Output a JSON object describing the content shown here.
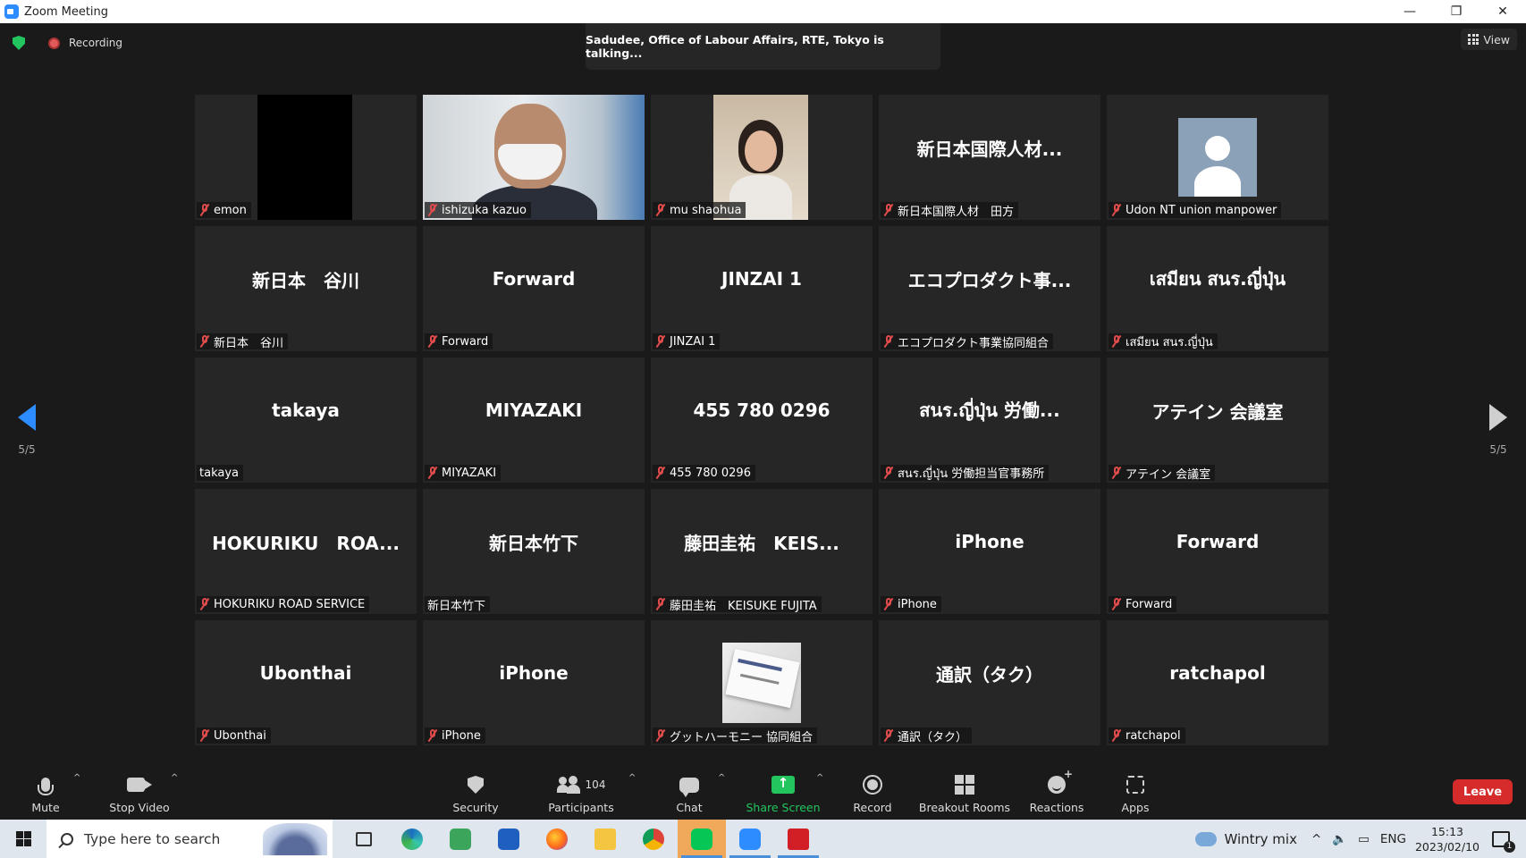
{
  "window": {
    "title": "Zoom Meeting",
    "minimize": "—",
    "restore": "❐",
    "close": "✕"
  },
  "topbar": {
    "recording": "Recording",
    "talking": "Sadudee, Office of Labour Affairs, RTE, Tokyo is talking...",
    "view_label": "View"
  },
  "pager": {
    "left": "5/5",
    "right": "5/5"
  },
  "tiles": [
    {
      "label": "emon",
      "big": "",
      "muted": true
    },
    {
      "label": "ishizuka kazuo",
      "big": "",
      "muted": true
    },
    {
      "label": "mu shaohua",
      "big": "",
      "muted": true
    },
    {
      "label": "新日本国際人材　田方",
      "big": "新日本国際人材...",
      "muted": true
    },
    {
      "label": "Udon NT union manpower",
      "big": "",
      "muted": true
    },
    {
      "label": "新日本　谷川",
      "big": "新日本　谷川",
      "muted": true
    },
    {
      "label": "Forward",
      "big": "Forward",
      "muted": true
    },
    {
      "label": "JINZAI 1",
      "big": "JINZAI 1",
      "muted": true
    },
    {
      "label": "エコプロダクト事業協同組合",
      "big": "エコプロダクト事...",
      "muted": true
    },
    {
      "label": "เสมียน สนร.ญี่ปุ่น",
      "big": "เสมียน สนร.ญี่ปุ่น",
      "muted": true
    },
    {
      "label": "takaya",
      "big": "takaya",
      "muted": false
    },
    {
      "label": "MIYAZAKI",
      "big": "MIYAZAKI",
      "muted": true
    },
    {
      "label": "455 780 0296",
      "big": "455 780 0296",
      "muted": true
    },
    {
      "label": "สนร.ญี่ปุ่น 労働担当官事務所",
      "big": "สนร.ญี่ปุ่น 労働...",
      "muted": true
    },
    {
      "label": "アテイン 会議室",
      "big": "アテイン 会議室",
      "muted": true
    },
    {
      "label": "HOKURIKU ROAD SERVICE",
      "big": "HOKURIKU　ROA...",
      "muted": true
    },
    {
      "label": "新日本竹下",
      "big": "新日本竹下",
      "muted": false
    },
    {
      "label": "藤田圭祐　KEISUKE FUJITA",
      "big": "藤田圭祐　KEIS...",
      "muted": true
    },
    {
      "label": "iPhone",
      "big": "iPhone",
      "muted": true
    },
    {
      "label": "Forward",
      "big": "Forward",
      "muted": true
    },
    {
      "label": "Ubonthai",
      "big": "Ubonthai",
      "muted": true
    },
    {
      "label": "iPhone",
      "big": "iPhone",
      "muted": true
    },
    {
      "label": "グットハーモニー 協同組合",
      "big": "",
      "muted": true
    },
    {
      "label": "通訳（タク）",
      "big": "通訳（タク）",
      "muted": true
    },
    {
      "label": "ratchapol",
      "big": "ratchapol",
      "muted": true
    }
  ],
  "toolbar": {
    "mute": "Mute",
    "stop_video": "Stop Video",
    "security": "Security",
    "participants": "Participants",
    "participants_count": "104",
    "chat": "Chat",
    "share_screen": "Share Screen",
    "record": "Record",
    "breakout_rooms": "Breakout Rooms",
    "reactions": "Reactions",
    "apps": "Apps",
    "leave": "Leave",
    "caret": "^",
    "share_color": "#23c55e",
    "leave_color": "#d52b2b"
  },
  "taskbar": {
    "search_placeholder": "Type here to search",
    "weather": "Wintry mix",
    "lang": "ENG",
    "time": "15:13",
    "date": "2023/02/10",
    "notifications": "1",
    "tray_up": "^"
  }
}
